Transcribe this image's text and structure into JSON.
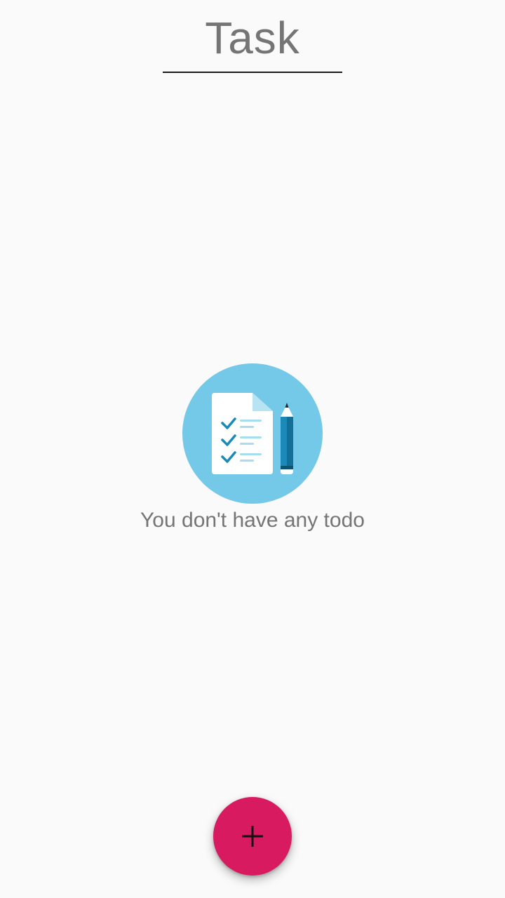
{
  "header": {
    "title": "Task"
  },
  "empty_state": {
    "illustration_icon": "todo-checklist-pencil-icon",
    "message": "You don't have any todo"
  },
  "fab": {
    "icon": "plus-icon",
    "color": "#d81b60"
  },
  "colors": {
    "background": "#fafafa",
    "illustration_circle": "#74c8e8",
    "accent": "#d81b60",
    "text_secondary": "#757575"
  }
}
